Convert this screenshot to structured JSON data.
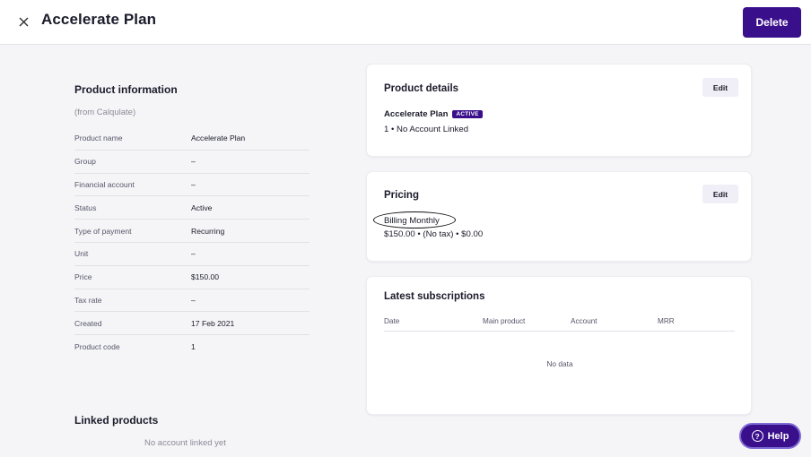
{
  "header": {
    "title": "Accelerate Plan",
    "delete_label": "Delete"
  },
  "product_information": {
    "heading": "Product information",
    "source": "(from Calqulate)",
    "rows": [
      {
        "label": "Product name",
        "value": "Accelerate Plan"
      },
      {
        "label": "Group",
        "value": "–"
      },
      {
        "label": "Financial account",
        "value": "–"
      },
      {
        "label": "Status",
        "value": "Active"
      },
      {
        "label": "Type of payment",
        "value": "Recurring"
      },
      {
        "label": "Unit",
        "value": "–"
      },
      {
        "label": "Price",
        "value": "$150.00"
      },
      {
        "label": "Tax rate",
        "value": "–"
      },
      {
        "label": "Created",
        "value": "17 Feb 2021"
      },
      {
        "label": "Product code",
        "value": "1"
      }
    ]
  },
  "linked_products": {
    "heading": "Linked products",
    "empty_text": "No account linked yet"
  },
  "product_details": {
    "title": "Product details",
    "edit_label": "Edit",
    "name": "Accelerate Plan",
    "badge": "ACTIVE",
    "subtitle": "1 • No Account Linked"
  },
  "pricing": {
    "title": "Pricing",
    "edit_label": "Edit",
    "billing": "Billing Monthly",
    "price_line": "$150.00 • (No tax) • $0.00"
  },
  "latest_subscriptions": {
    "title": "Latest subscriptions",
    "columns": [
      "Date",
      "Main product",
      "Account",
      "MRR"
    ],
    "empty_text": "No data"
  },
  "help": {
    "label": "Help"
  },
  "colors": {
    "accent": "#3a0f8c",
    "background": "#f5f5f7"
  }
}
